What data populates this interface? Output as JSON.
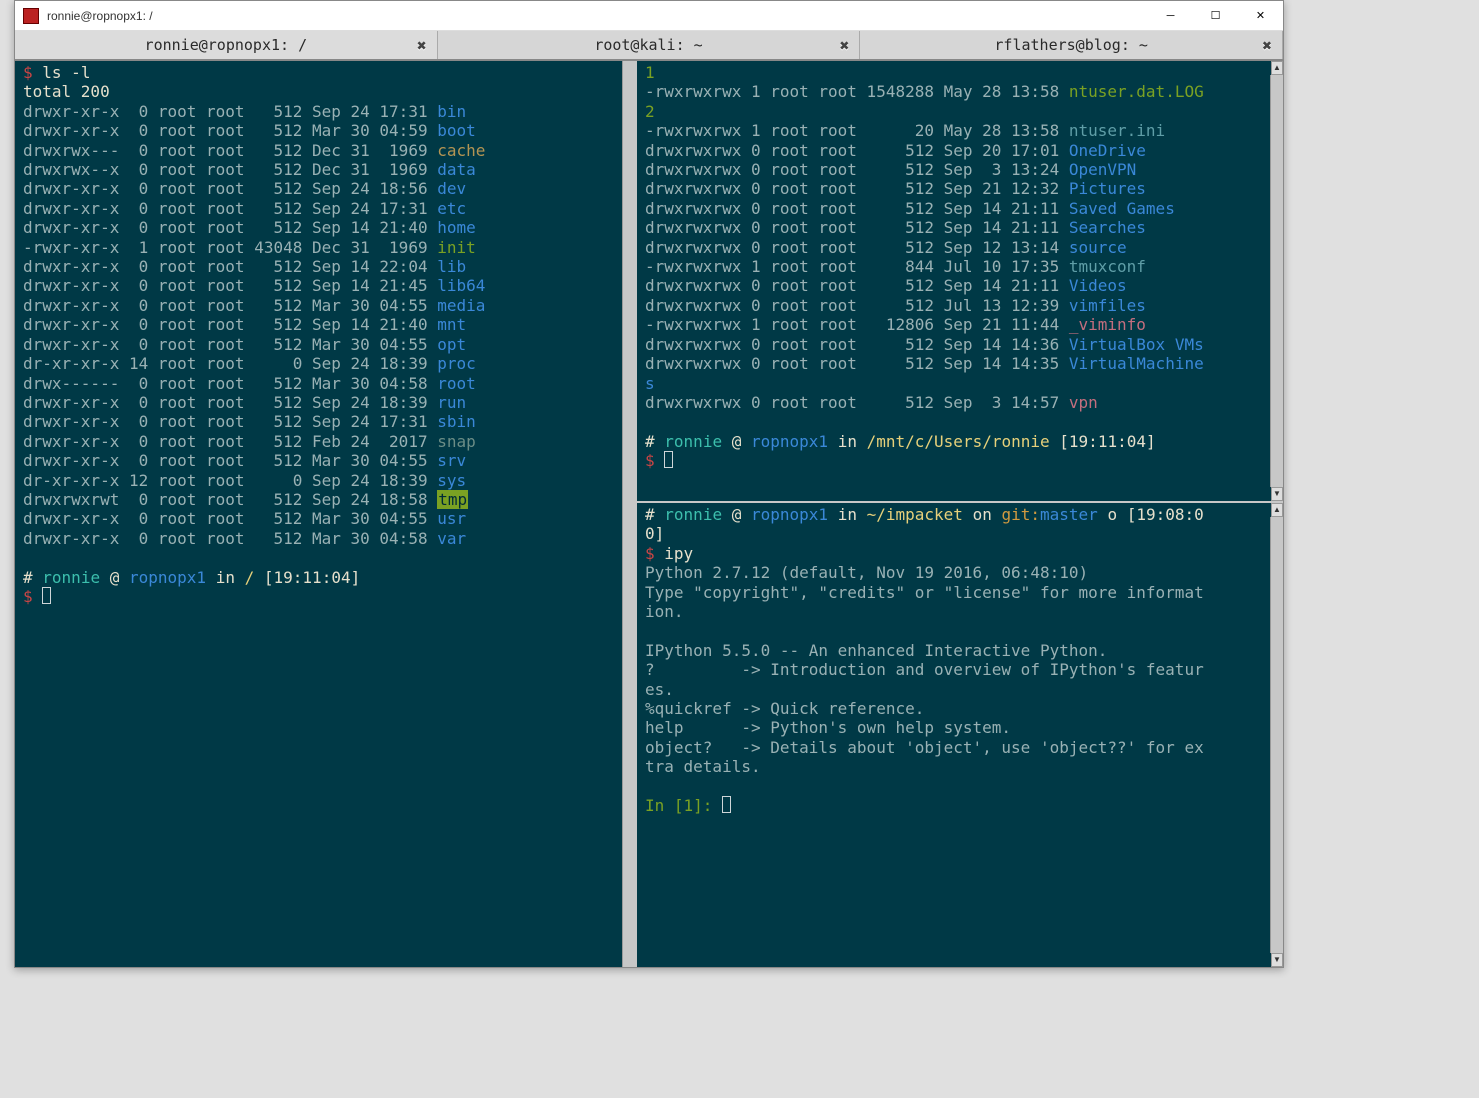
{
  "window": {
    "title": "ronnie@ropnopx1: /"
  },
  "tabs": [
    {
      "label": "ronnie@ropnopx1: /"
    },
    {
      "label": "root@kali: ~"
    },
    {
      "label": "rflathers@blog: ~"
    }
  ],
  "left": {
    "cmd": "ls -l",
    "total": "total 200",
    "rows": [
      {
        "perm": "drwxr-xr-x",
        "n": " 0",
        "o": "root",
        "g": "root",
        "sz": "  512",
        "date": "Sep 24 17:31",
        "name": "bin",
        "cls": "dir"
      },
      {
        "perm": "drwxr-xr-x",
        "n": " 0",
        "o": "root",
        "g": "root",
        "sz": "  512",
        "date": "Mar 30 04:59",
        "name": "boot",
        "cls": "dir"
      },
      {
        "perm": "drwxrwx---",
        "n": " 0",
        "o": "root",
        "g": "root",
        "sz": "  512",
        "date": "Dec 31  1969",
        "name": "cache",
        "cls": "cache"
      },
      {
        "perm": "drwxrwx--x",
        "n": " 0",
        "o": "root",
        "g": "root",
        "sz": "  512",
        "date": "Dec 31  1969",
        "name": "data",
        "cls": "dir"
      },
      {
        "perm": "drwxr-xr-x",
        "n": " 0",
        "o": "root",
        "g": "root",
        "sz": "  512",
        "date": "Sep 24 18:56",
        "name": "dev",
        "cls": "dir"
      },
      {
        "perm": "drwxr-xr-x",
        "n": " 0",
        "o": "root",
        "g": "root",
        "sz": "  512",
        "date": "Sep 24 17:31",
        "name": "etc",
        "cls": "dir"
      },
      {
        "perm": "drwxr-xr-x",
        "n": " 0",
        "o": "root",
        "g": "root",
        "sz": "  512",
        "date": "Sep 14 21:40",
        "name": "home",
        "cls": "dir"
      },
      {
        "perm": "-rwxr-xr-x",
        "n": " 1",
        "o": "root",
        "g": "root",
        "sz": "43048",
        "date": "Dec 31  1969",
        "name": "init",
        "cls": "grn"
      },
      {
        "perm": "drwxr-xr-x",
        "n": " 0",
        "o": "root",
        "g": "root",
        "sz": "  512",
        "date": "Sep 14 22:04",
        "name": "lib",
        "cls": "dir"
      },
      {
        "perm": "drwxr-xr-x",
        "n": " 0",
        "o": "root",
        "g": "root",
        "sz": "  512",
        "date": "Sep 14 21:45",
        "name": "lib64",
        "cls": "dir"
      },
      {
        "perm": "drwxr-xr-x",
        "n": " 0",
        "o": "root",
        "g": "root",
        "sz": "  512",
        "date": "Mar 30 04:55",
        "name": "media",
        "cls": "dir"
      },
      {
        "perm": "drwxr-xr-x",
        "n": " 0",
        "o": "root",
        "g": "root",
        "sz": "  512",
        "date": "Sep 14 21:40",
        "name": "mnt",
        "cls": "dir"
      },
      {
        "perm": "drwxr-xr-x",
        "n": " 0",
        "o": "root",
        "g": "root",
        "sz": "  512",
        "date": "Mar 30 04:55",
        "name": "opt",
        "cls": "dir"
      },
      {
        "perm": "dr-xr-xr-x",
        "n": "14",
        "o": "root",
        "g": "root",
        "sz": "    0",
        "date": "Sep 24 18:39",
        "name": "proc",
        "cls": "dir"
      },
      {
        "perm": "drwx------",
        "n": " 0",
        "o": "root",
        "g": "root",
        "sz": "  512",
        "date": "Mar 30 04:58",
        "name": "root",
        "cls": "dir"
      },
      {
        "perm": "drwxr-xr-x",
        "n": " 0",
        "o": "root",
        "g": "root",
        "sz": "  512",
        "date": "Sep 24 18:39",
        "name": "run",
        "cls": "dir"
      },
      {
        "perm": "drwxr-xr-x",
        "n": " 0",
        "o": "root",
        "g": "root",
        "sz": "  512",
        "date": "Sep 24 17:31",
        "name": "sbin",
        "cls": "dir"
      },
      {
        "perm": "drwxr-xr-x",
        "n": " 0",
        "o": "root",
        "g": "root",
        "sz": "  512",
        "date": "Feb 24  2017",
        "name": "snap",
        "cls": "snap"
      },
      {
        "perm": "drwxr-xr-x",
        "n": " 0",
        "o": "root",
        "g": "root",
        "sz": "  512",
        "date": "Mar 30 04:55",
        "name": "srv",
        "cls": "dir"
      },
      {
        "perm": "dr-xr-xr-x",
        "n": "12",
        "o": "root",
        "g": "root",
        "sz": "    0",
        "date": "Sep 24 18:39",
        "name": "sys",
        "cls": "dir"
      },
      {
        "perm": "drwxrwxrwt",
        "n": " 0",
        "o": "root",
        "g": "root",
        "sz": "  512",
        "date": "Sep 24 18:58",
        "name": "tmp",
        "cls": "tmpbox"
      },
      {
        "perm": "drwxr-xr-x",
        "n": " 0",
        "o": "root",
        "g": "root",
        "sz": "  512",
        "date": "Mar 30 04:55",
        "name": "usr",
        "cls": "dir"
      },
      {
        "perm": "drwxr-xr-x",
        "n": " 0",
        "o": "root",
        "g": "root",
        "sz": "  512",
        "date": "Mar 30 04:58",
        "name": "var",
        "cls": "dir"
      }
    ],
    "prompt": {
      "user": "ronnie",
      "host": "ropnopx1",
      "path": "/",
      "time": "[19:11:04]"
    }
  },
  "top": {
    "preline": "1",
    "rows": [
      {
        "perm": "-rwxrwxrwx",
        "n": "1",
        "o": "root",
        "g": "root",
        "sz": "1548288",
        "date": "May 28 13:58",
        "name": "ntuser.dat.LOG2",
        "cls": "grn",
        "wrap": true
      },
      {
        "perm": "-rwxrwxrwx",
        "n": "1",
        "o": "root",
        "g": "root",
        "sz": "     20",
        "date": "May 28 13:58",
        "name": "ntuser.ini",
        "cls": "ini"
      },
      {
        "perm": "drwxrwxrwx",
        "n": "0",
        "o": "root",
        "g": "root",
        "sz": "    512",
        "date": "Sep 20 17:01",
        "name": "OneDrive",
        "cls": "dir"
      },
      {
        "perm": "drwxrwxrwx",
        "n": "0",
        "o": "root",
        "g": "root",
        "sz": "    512",
        "date": "Sep  3 13:24",
        "name": "OpenVPN",
        "cls": "dir"
      },
      {
        "perm": "drwxrwxrwx",
        "n": "0",
        "o": "root",
        "g": "root",
        "sz": "    512",
        "date": "Sep 21 12:32",
        "name": "Pictures",
        "cls": "dir"
      },
      {
        "perm": "drwxrwxrwx",
        "n": "0",
        "o": "root",
        "g": "root",
        "sz": "    512",
        "date": "Sep 14 21:11",
        "name": "Saved Games",
        "cls": "dir"
      },
      {
        "perm": "drwxrwxrwx",
        "n": "0",
        "o": "root",
        "g": "root",
        "sz": "    512",
        "date": "Sep 14 21:11",
        "name": "Searches",
        "cls": "dir"
      },
      {
        "perm": "drwxrwxrwx",
        "n": "0",
        "o": "root",
        "g": "root",
        "sz": "    512",
        "date": "Sep 12 13:14",
        "name": "source",
        "cls": "dir"
      },
      {
        "perm": "-rwxrwxrwx",
        "n": "1",
        "o": "root",
        "g": "root",
        "sz": "    844",
        "date": "Jul 10 17:35",
        "name": "tmuxconf",
        "cls": "ini"
      },
      {
        "perm": "drwxrwxrwx",
        "n": "0",
        "o": "root",
        "g": "root",
        "sz": "    512",
        "date": "Sep 14 21:11",
        "name": "Videos",
        "cls": "dir"
      },
      {
        "perm": "drwxrwxrwx",
        "n": "0",
        "o": "root",
        "g": "root",
        "sz": "    512",
        "date": "Jul 13 12:39",
        "name": "vimfiles",
        "cls": "dir"
      },
      {
        "perm": "-rwxrwxrwx",
        "n": "1",
        "o": "root",
        "g": "root",
        "sz": "  12806",
        "date": "Sep 21 11:44",
        "name": "_viminfo",
        "cls": "vimi"
      },
      {
        "perm": "drwxrwxrwx",
        "n": "0",
        "o": "root",
        "g": "root",
        "sz": "    512",
        "date": "Sep 14 14:36",
        "name": "VirtualBox VMs",
        "cls": "dir"
      },
      {
        "perm": "drwxrwxrwx",
        "n": "0",
        "o": "root",
        "g": "root",
        "sz": "    512",
        "date": "Sep 14 14:35",
        "name": "VirtualMachines",
        "cls": "dir",
        "wrap": true
      },
      {
        "perm": "drwxrwxrwx",
        "n": "0",
        "o": "root",
        "g": "root",
        "sz": "    512",
        "date": "Sep  3 14:57",
        "name": "vpn",
        "cls": "vimi"
      }
    ],
    "prompt": {
      "user": "ronnie",
      "host": "ropnopx1",
      "path": "/mnt/c/Users/ronnie",
      "time": "[19:11:04]"
    }
  },
  "bottom": {
    "prompt": {
      "user": "ronnie",
      "host": "ropnopx1",
      "path": "~/impacket",
      "git": "git:",
      "branch": "master",
      "o": "o",
      "time": "[19:08:00]"
    },
    "cmd": "ipy",
    "lines": [
      "Python 2.7.12 (default, Nov 19 2016, 06:48:10)",
      "Type \"copyright\", \"credits\" or \"license\" for more information.",
      "",
      "IPython 5.5.0 -- An enhanced Interactive Python.",
      "?         -> Introduction and overview of IPython's features.",
      "%quickref -> Quick reference.",
      "help      -> Python's own help system.",
      "object?   -> Details about 'object', use 'object??' for extra details."
    ],
    "ipy": "In [1]: "
  }
}
